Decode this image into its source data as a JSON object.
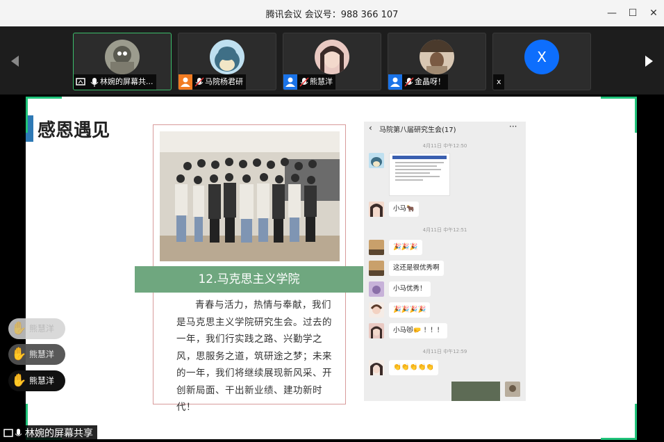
{
  "window": {
    "title": "腾讯会议 会议号：988 366 107",
    "controls": [
      "minimize",
      "maximize",
      "close"
    ]
  },
  "participants": [
    {
      "name": "林婉的屏幕共...",
      "mic": "on",
      "badge": "screen",
      "active": true,
      "avatar": "photo"
    },
    {
      "name": "马院杨君研",
      "mic": "muted",
      "badge": "orange-user",
      "active": false,
      "avatar": "photo"
    },
    {
      "name": "熊慧洋",
      "mic": "muted",
      "badge": "blue-user",
      "active": false,
      "avatar": "photo"
    },
    {
      "name": "金晶呀！",
      "mic": "muted",
      "badge": "blue-user",
      "active": false,
      "avatar": "photo"
    },
    {
      "name": "x",
      "mic": "none",
      "badge": "none",
      "active": false,
      "avatar": "X"
    }
  ],
  "slide": {
    "heading": "感恩遇见",
    "card": {
      "band_title": "12.马克思主义学院",
      "body": "青春与活力，热情与奉献，我们是马克思主义学院研究生会。过去的一年，我们行实践之路、兴勤学之风，思服务之道，筑研途之梦；未来的一年，我们将继续展现新风采、开创新局面、干出新业绩、建功新时代！"
    },
    "chat": {
      "title": "马院第八届研究生会(17)",
      "timestamps": [
        "4月11日 中午12:50",
        "4月11日 中午12:51",
        "4月11日 中午12:59"
      ],
      "messages": [
        "小马🐂",
        "🎉🎉🎉",
        "这还是很优秀啊",
        "小马优秀！",
        "🎉🎉🎉🎉",
        "小马😻🤛 ！！！",
        "👏👏👏👏👏"
      ]
    }
  },
  "reactions": [
    {
      "name": "熊慧洋",
      "style": "faded"
    },
    {
      "name": "熊慧洋",
      "style": "mid"
    },
    {
      "name": "熊慧洋",
      "style": "dark"
    }
  ],
  "share_label": "林婉的屏幕共享",
  "colors": {
    "accent_green": "#1fc37a",
    "band_green": "#6fa77f",
    "blue_x": "#0d6efd",
    "orange": "#f27c22"
  }
}
